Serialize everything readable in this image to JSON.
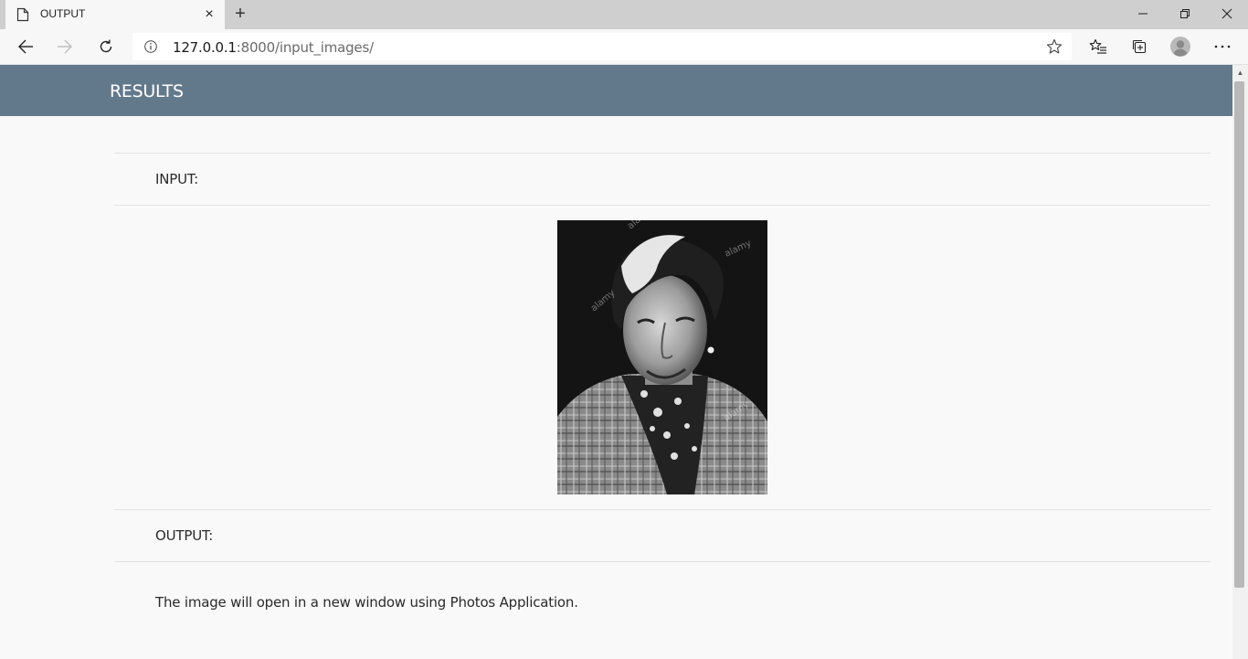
{
  "browser": {
    "tab_title": "OUTPUT",
    "tab_close": "×",
    "new_tab": "+",
    "url_host": "127.0.0.1",
    "url_rest": ":8000/input_images/"
  },
  "page": {
    "header_title": "RESULTS",
    "input_label": "INPUT:",
    "output_label": "OUTPUT:",
    "message": "The image will open in a new window using Photos Application.",
    "image_watermark": "alamy"
  },
  "colors": {
    "header_bg": "#62798c",
    "page_bg": "#f9f9f9"
  }
}
